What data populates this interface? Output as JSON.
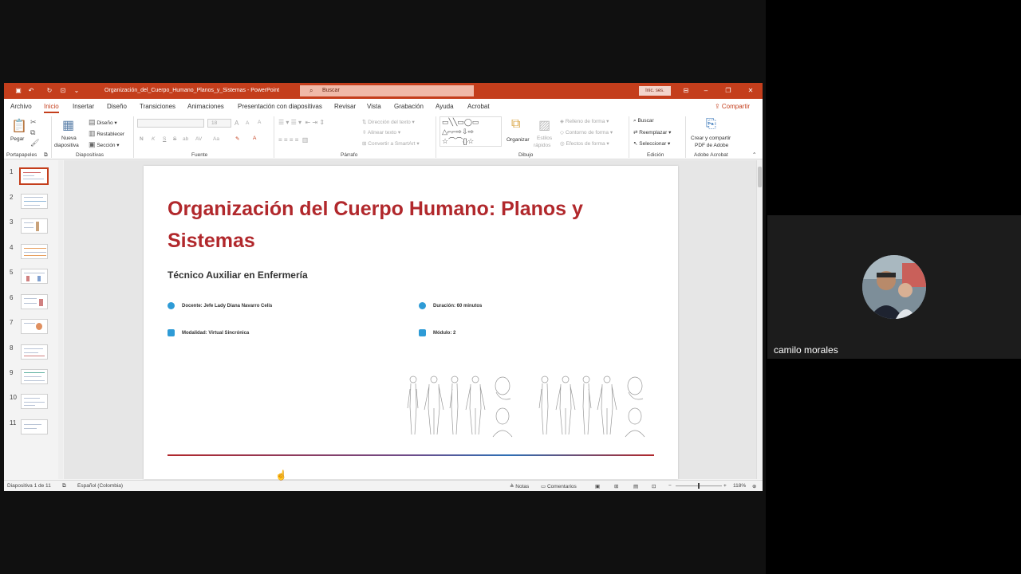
{
  "window": {
    "title": "Organización_del_Cuerpo_Humano_Planos_y_Sistemas  -  PowerPoint",
    "search_placeholder": "Buscar",
    "signin": "Inic. ses."
  },
  "tabs": [
    "Archivo",
    "Inicio",
    "Insertar",
    "Diseño",
    "Transiciones",
    "Animaciones",
    "Presentación con diapositivas",
    "Revisar",
    "Vista",
    "Grabación",
    "Ayuda",
    "Acrobat"
  ],
  "share_label": "Compartir",
  "ribbon": {
    "portapapeles": {
      "label": "Portapapeles",
      "paste": "Pegar"
    },
    "diapositivas": {
      "label": "Diapositivas",
      "new_slide_1": "Nueva",
      "new_slide_2": "diapositiva",
      "layout": "Diseño",
      "reset": "Restablecer",
      "section": "Sección"
    },
    "fuente": {
      "label": "Fuente",
      "bold": "N",
      "italic": "K",
      "underline": "S",
      "strike": "S",
      "shadow": "ab",
      "spacing": "AV",
      "case": "Aa",
      "grow": "A",
      "shrink": "A",
      "clear": "A",
      "font_size": "18"
    },
    "parrafo": {
      "label": "Párrafo",
      "text_direction": "Dirección del texto",
      "align_text": "Alinear texto",
      "smartart": "Convertir a SmartArt"
    },
    "dibujo": {
      "label": "Dibujo",
      "arrange": "Organizar",
      "quick_styles_1": "Estilos",
      "quick_styles_2": "rápidos",
      "fill": "Relleno de forma",
      "outline": "Contorno de forma",
      "effects": "Efectos de forma"
    },
    "edicion": {
      "label": "Edición",
      "find": "Buscar",
      "replace": "Reemplazar",
      "select": "Seleccionar"
    },
    "acrobat": {
      "label": "Adobe Acrobat",
      "create_1": "Crear y compartir",
      "create_2": "PDF de Adobe"
    }
  },
  "thumbnails": [
    "1",
    "2",
    "3",
    "4",
    "5",
    "6",
    "7",
    "8",
    "9",
    "10",
    "11"
  ],
  "slide": {
    "title": "Organización del Cuerpo Humano: Planos y Sistemas",
    "subtitle": "Técnico Auxiliar en Enfermería",
    "docente": "Docente: Jefe Lady Diana Navarro Celis",
    "duracion": "Duración: 60 minutos",
    "modalidad": "Modalidad: Virtual Sincrónica",
    "modulo": "Módulo: 2"
  },
  "status": {
    "slide_count": "Diapositiva 1 de 11",
    "language": "Español (Colombia)",
    "notes": "Notas",
    "comments": "Comentarios",
    "zoom": "118%"
  },
  "participant": {
    "name": "camilo morales"
  },
  "colors": {
    "accent": "#c43e1c",
    "slide_title": "#b1282c",
    "icon_blue": "#2e9bd6"
  }
}
